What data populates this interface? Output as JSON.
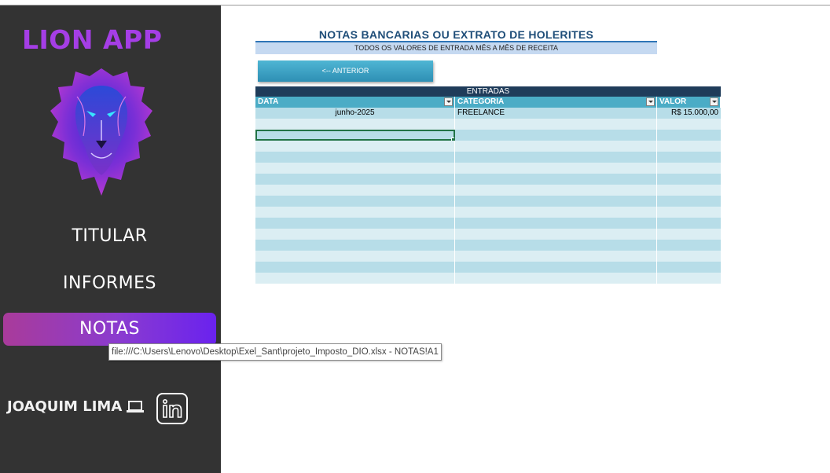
{
  "app": {
    "title": "LION APP"
  },
  "sidebar": {
    "items": [
      {
        "label": "TITULAR"
      },
      {
        "label": "INFORMES"
      },
      {
        "label": "NOTAS",
        "active": true
      }
    ],
    "author": "JOAQUIM LIMA",
    "icons": [
      "lion-logo",
      "laptop-icon",
      "linkedin-icon"
    ]
  },
  "tooltip": "file:///C:\\Users\\Lenovo\\Desktop\\Exel_Sant\\projeto_Imposto_DIO.xlsx - NOTAS!A1",
  "sheet": {
    "title": "NOTAS BANCARIAS OU EXTRATO DE HOLERITES",
    "subtitle": "TODOS OS VALORES DE ENTRADA MÊS A MÊS DE RECEITA",
    "back_button": "<-- ANTERIOR"
  },
  "table": {
    "group_header": "ENTRADAS",
    "columns": [
      "DATA",
      "CATEGORIA",
      "VALOR"
    ],
    "rows": [
      {
        "data": "junho-2025",
        "categoria": "FREELANCE",
        "valor": "R$ 15.000,00"
      }
    ],
    "empty_rows": 15
  },
  "colors": {
    "sidebar_bg": "#333333",
    "app_title": "#a53ee6",
    "active_nav_start": "#a93b9a",
    "active_nav_end": "#6a22ee",
    "header_dark": "#1f3c5a",
    "header_teal": "#4bacc6",
    "row_band_1": "#b7dde8",
    "row_band_2": "#dbeef3",
    "title_blue": "#1f4e79"
  }
}
